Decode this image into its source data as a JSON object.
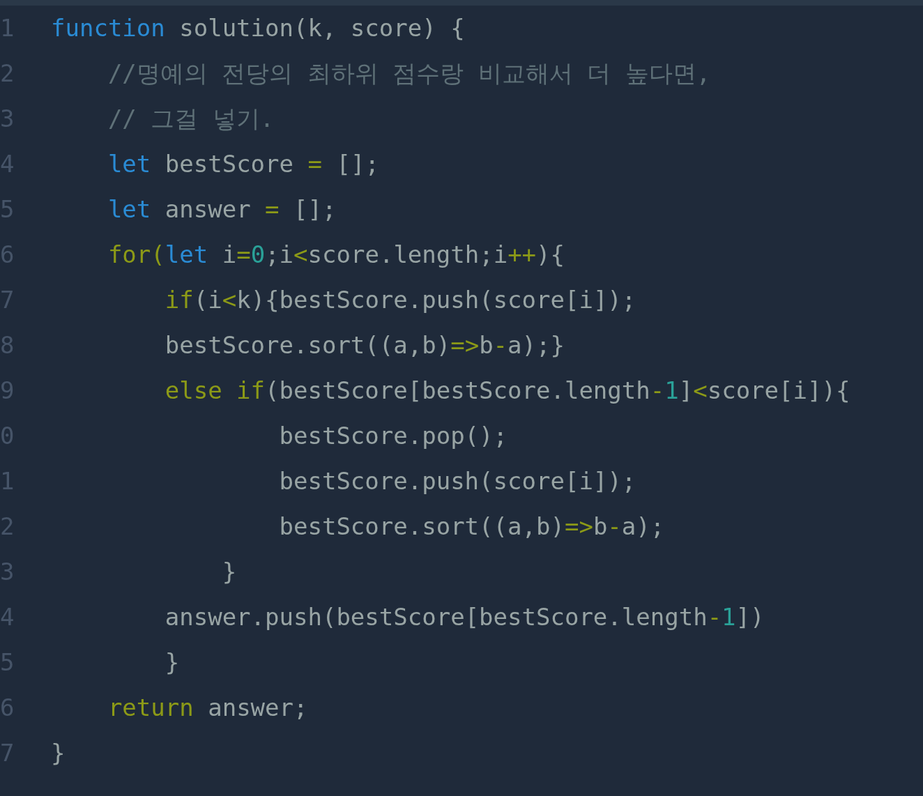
{
  "editor": {
    "lines": [
      {
        "number": "1",
        "tokens": [
          {
            "kind": "keyword",
            "text": "function"
          },
          {
            "kind": "plain",
            "text": " solution(k, score) {"
          }
        ]
      },
      {
        "number": "2",
        "tokens": [
          {
            "kind": "comment",
            "text": "    //명예의 전당의 최하위 점수랑 비교해서 더 높다면,"
          }
        ]
      },
      {
        "number": "3",
        "tokens": [
          {
            "kind": "comment",
            "text": "    // 그걸 넣기."
          }
        ]
      },
      {
        "number": "4",
        "tokens": [
          {
            "kind": "keyword",
            "text": "    let"
          },
          {
            "kind": "plain",
            "text": " bestScore "
          },
          {
            "kind": "operator",
            "text": "="
          },
          {
            "kind": "plain",
            "text": " [];"
          }
        ]
      },
      {
        "number": "5",
        "tokens": [
          {
            "kind": "keyword",
            "text": "    let"
          },
          {
            "kind": "plain",
            "text": " answer "
          },
          {
            "kind": "operator",
            "text": "="
          },
          {
            "kind": "plain",
            "text": " [];"
          }
        ]
      },
      {
        "number": "6",
        "tokens": [
          {
            "kind": "control",
            "text": "    for("
          },
          {
            "kind": "keyword",
            "text": "let"
          },
          {
            "kind": "plain",
            "text": " i"
          },
          {
            "kind": "operator",
            "text": "="
          },
          {
            "kind": "number",
            "text": "0"
          },
          {
            "kind": "plain",
            "text": ";i"
          },
          {
            "kind": "operator",
            "text": "<"
          },
          {
            "kind": "plain",
            "text": "score.length;i"
          },
          {
            "kind": "operator",
            "text": "++"
          },
          {
            "kind": "plain",
            "text": "){"
          }
        ]
      },
      {
        "number": "7",
        "tokens": [
          {
            "kind": "control",
            "text": "        if"
          },
          {
            "kind": "plain",
            "text": "(i"
          },
          {
            "kind": "operator",
            "text": "<"
          },
          {
            "kind": "plain",
            "text": "k){bestScore.push(score[i]);"
          }
        ]
      },
      {
        "number": "8",
        "tokens": [
          {
            "kind": "plain",
            "text": "        bestScore.sort((a,b)"
          },
          {
            "kind": "operator",
            "text": "=>"
          },
          {
            "kind": "plain",
            "text": "b"
          },
          {
            "kind": "operator",
            "text": "-"
          },
          {
            "kind": "plain",
            "text": "a);}"
          }
        ]
      },
      {
        "number": "9",
        "tokens": [
          {
            "kind": "control",
            "text": "        else if"
          },
          {
            "kind": "plain",
            "text": "(bestScore[bestScore.length"
          },
          {
            "kind": "operator",
            "text": "-"
          },
          {
            "kind": "number",
            "text": "1"
          },
          {
            "kind": "plain",
            "text": "]"
          },
          {
            "kind": "operator",
            "text": "<"
          },
          {
            "kind": "plain",
            "text": "score[i]){"
          }
        ]
      },
      {
        "number": "0",
        "tokens": [
          {
            "kind": "plain",
            "text": "                bestScore.pop();"
          }
        ]
      },
      {
        "number": "1",
        "tokens": [
          {
            "kind": "plain",
            "text": "                bestScore.push(score[i]);"
          }
        ]
      },
      {
        "number": "2",
        "tokens": [
          {
            "kind": "plain",
            "text": "                bestScore.sort((a,b)"
          },
          {
            "kind": "operator",
            "text": "=>"
          },
          {
            "kind": "plain",
            "text": "b"
          },
          {
            "kind": "operator",
            "text": "-"
          },
          {
            "kind": "plain",
            "text": "a);"
          }
        ]
      },
      {
        "number": "3",
        "tokens": [
          {
            "kind": "plain",
            "text": "            }"
          }
        ]
      },
      {
        "number": "4",
        "tokens": [
          {
            "kind": "plain",
            "text": "        answer.push(bestScore[bestScore.length"
          },
          {
            "kind": "operator",
            "text": "-"
          },
          {
            "kind": "number",
            "text": "1"
          },
          {
            "kind": "plain",
            "text": "])"
          }
        ]
      },
      {
        "number": "5",
        "tokens": [
          {
            "kind": "plain",
            "text": "        }"
          }
        ]
      },
      {
        "number": "6",
        "tokens": [
          {
            "kind": "control",
            "text": "    return"
          },
          {
            "kind": "plain",
            "text": " answer;"
          }
        ]
      },
      {
        "number": "7",
        "tokens": [
          {
            "kind": "plain",
            "text": "}"
          }
        ]
      }
    ]
  }
}
